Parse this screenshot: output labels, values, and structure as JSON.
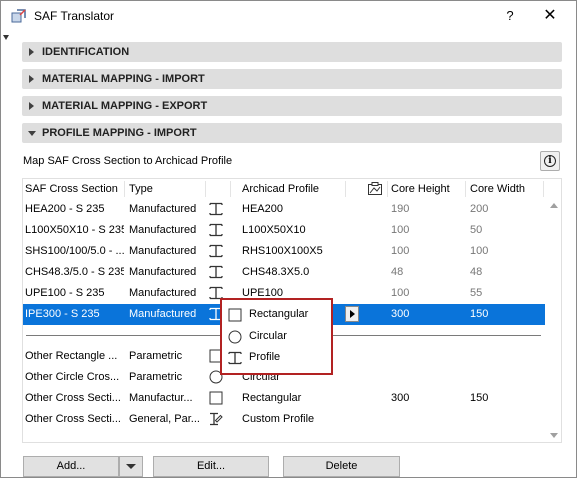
{
  "window": {
    "title": "SAF Translator",
    "help_label": "?",
    "close_label": "✕"
  },
  "sections": [
    {
      "label": "IDENTIFICATION",
      "open": false
    },
    {
      "label": "MATERIAL MAPPING - IMPORT",
      "open": false
    },
    {
      "label": "MATERIAL MAPPING - EXPORT",
      "open": false
    },
    {
      "label": "PROFILE MAPPING - IMPORT",
      "open": true
    }
  ],
  "description": "Map SAF Cross Section to Archicad Profile",
  "info_label": "i",
  "table": {
    "headers": {
      "saf_cross_section": "SAF Cross Section",
      "type": "Type",
      "archicad_profile": "Archicad Profile",
      "core_height": "Core Height",
      "core_width": "Core Width"
    },
    "rows": [
      {
        "section": "HEA200 - S 235",
        "type": "Manufactured",
        "profile": "HEA200",
        "height": "190",
        "width": "200",
        "icon": "i-beam-icon"
      },
      {
        "section": "L100X50X10 - S 235",
        "type": "Manufactured",
        "profile": "L100X50X10",
        "height": "100",
        "width": "50",
        "icon": "i-beam-icon"
      },
      {
        "section": "SHS100/100/5.0 - ...",
        "type": "Manufactured",
        "profile": "RHS100X100X5",
        "height": "100",
        "width": "100",
        "icon": "i-beam-icon"
      },
      {
        "section": "CHS48.3/5.0 - S 235",
        "type": "Manufactured",
        "profile": "CHS48.3X5.0",
        "height": "48",
        "width": "48",
        "icon": "i-beam-icon"
      },
      {
        "section": "UPE100 - S 235",
        "type": "Manufactured",
        "profile": "UPE100",
        "height": "100",
        "width": "55",
        "icon": "i-beam-icon"
      },
      {
        "section": "IPE300 - S 235",
        "type": "Manufactured",
        "profile": "",
        "height": "300",
        "width": "150",
        "icon": "i-beam-icon",
        "selected": true
      }
    ],
    "other_rows": [
      {
        "section": "Other Rectangle ...",
        "type": "Parametric",
        "profile": "",
        "height": "",
        "width": "",
        "icon": "rectangle-icon"
      },
      {
        "section": "Other Circle Cros...",
        "type": "Parametric",
        "profile": "Circular",
        "height": "",
        "width": "",
        "icon": "circle-icon"
      },
      {
        "section": "Other Cross Secti...",
        "type": "Manufactur...",
        "profile": "Rectangular",
        "height": "300",
        "width": "150",
        "icon": "rectangle-icon"
      },
      {
        "section": "Other Cross Secti...",
        "type": "General, Par...",
        "profile": "Custom Profile",
        "height": "",
        "width": "",
        "icon": "custom-profile-icon"
      }
    ]
  },
  "popup": {
    "options": [
      {
        "label": "Rectangular",
        "icon": "rectangle-icon"
      },
      {
        "label": "Circular",
        "icon": "circle-icon"
      },
      {
        "label": "Profile",
        "icon": "i-beam-icon"
      }
    ]
  },
  "buttons": {
    "add": "Add...",
    "edit": "Edit...",
    "delete": "Delete"
  },
  "colors": {
    "selection": "#0a74da",
    "highlight_border": "#b22222",
    "section_bg": "#dedede"
  }
}
